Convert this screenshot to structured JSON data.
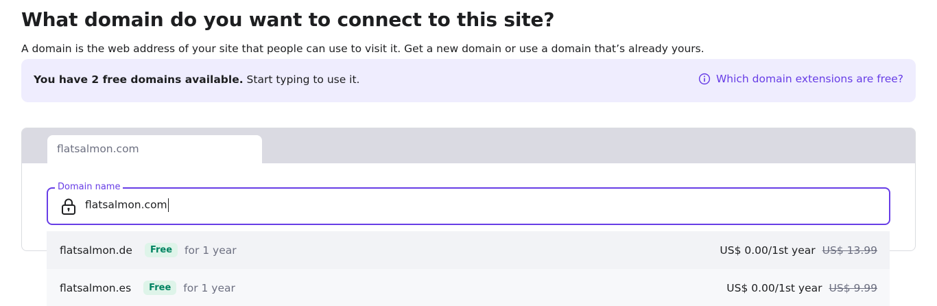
{
  "page": {
    "title": "What domain do you want to connect to this site?",
    "subtitle": "A domain is the web address of your site that people can use to visit it. Get a new domain or use a domain that’s already yours."
  },
  "banner": {
    "bold_text": "You have 2 free domains available.",
    "text": " Start typing to use it.",
    "link_label": "Which domain extensions are free?",
    "link_icon": "info-icon"
  },
  "tabs": [
    {
      "label": "flatsalmon.com"
    }
  ],
  "domain_field": {
    "label": "Domain name",
    "value": "flatsalmon.com",
    "icon": "lock-icon"
  },
  "suggestions": [
    {
      "name": "flatsalmon.de",
      "badge": "Free",
      "term": "for 1 year",
      "price": "US$ 0.00/1st year",
      "old_price": "US$ 13.99"
    },
    {
      "name": "flatsalmon.es",
      "badge": "Free",
      "term": "for 1 year",
      "price": "US$ 0.00/1st year",
      "old_price": "US$ 9.99"
    }
  ],
  "colors": {
    "accent": "#673de6",
    "banner_bg": "#efedfe",
    "badge_bg": "#def4e9",
    "badge_text": "#008361",
    "tab_bar": "#dadae2"
  }
}
